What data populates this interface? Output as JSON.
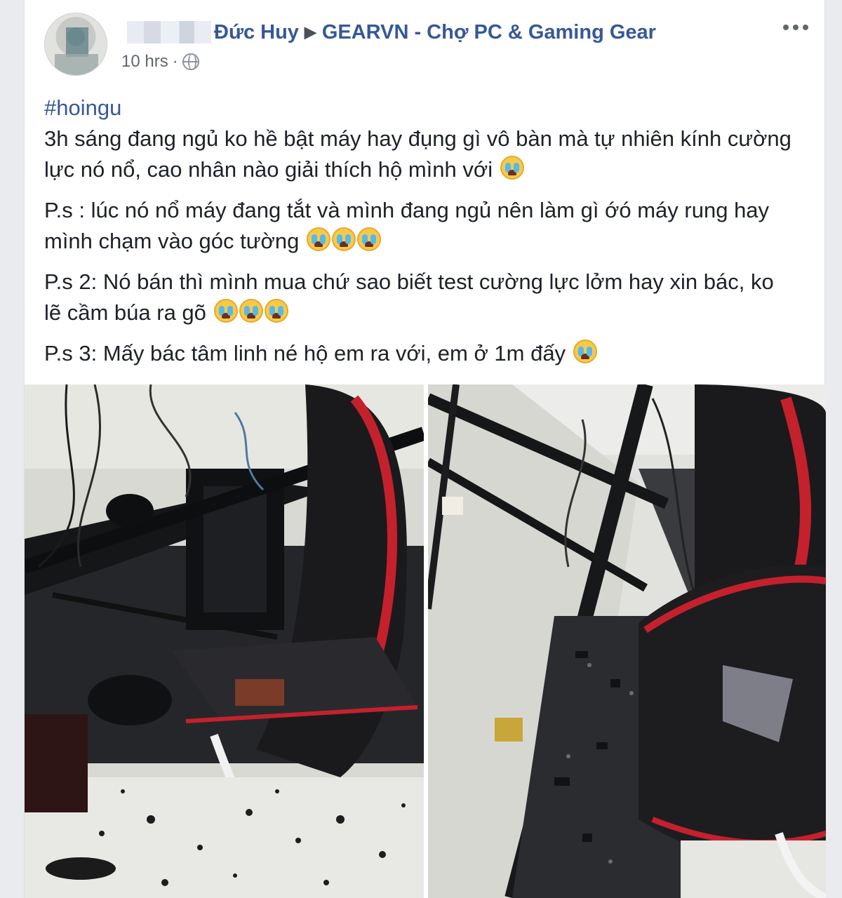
{
  "post": {
    "author_visible": "Đức Huy",
    "group": "GEARVN - Chợ PC & Gaming Gear",
    "time": "10 hrs",
    "separator": "·",
    "more_icon": "more-options-icon",
    "privacy_icon": "globe-icon"
  },
  "content": {
    "hashtag": "#hoingu",
    "paragraphs": [
      "3h sáng đang ngủ ko hề bật máy hay đụng gì vô bàn mà tự nhiên kính cường lực nó nổ, cao nhân nào giải thích hộ mình với",
      "P.s : lúc nó nổ máy đang tắt và mình đang ngủ nên làm gì ớó máy rung hay mình chạm vào góc tường",
      "P.s 2: Nó bán thì mình mua chứ sao biết test cường lực lởm hay xin bác, ko lẽ cầm búa ra gõ",
      "P.s 3: Mấy bác tâm linh né hộ em ra với, em ở 1m đấy"
    ],
    "emoji_counts": [
      1,
      3,
      3,
      1
    ],
    "emoji_icon": "crying-face-icon"
  },
  "colors": {
    "link": "#365899",
    "text": "#1d2129",
    "meta": "#616770",
    "background": "#e9ebee",
    "chair_red": "#c4212d",
    "chair_black": "#1c1c1e"
  }
}
